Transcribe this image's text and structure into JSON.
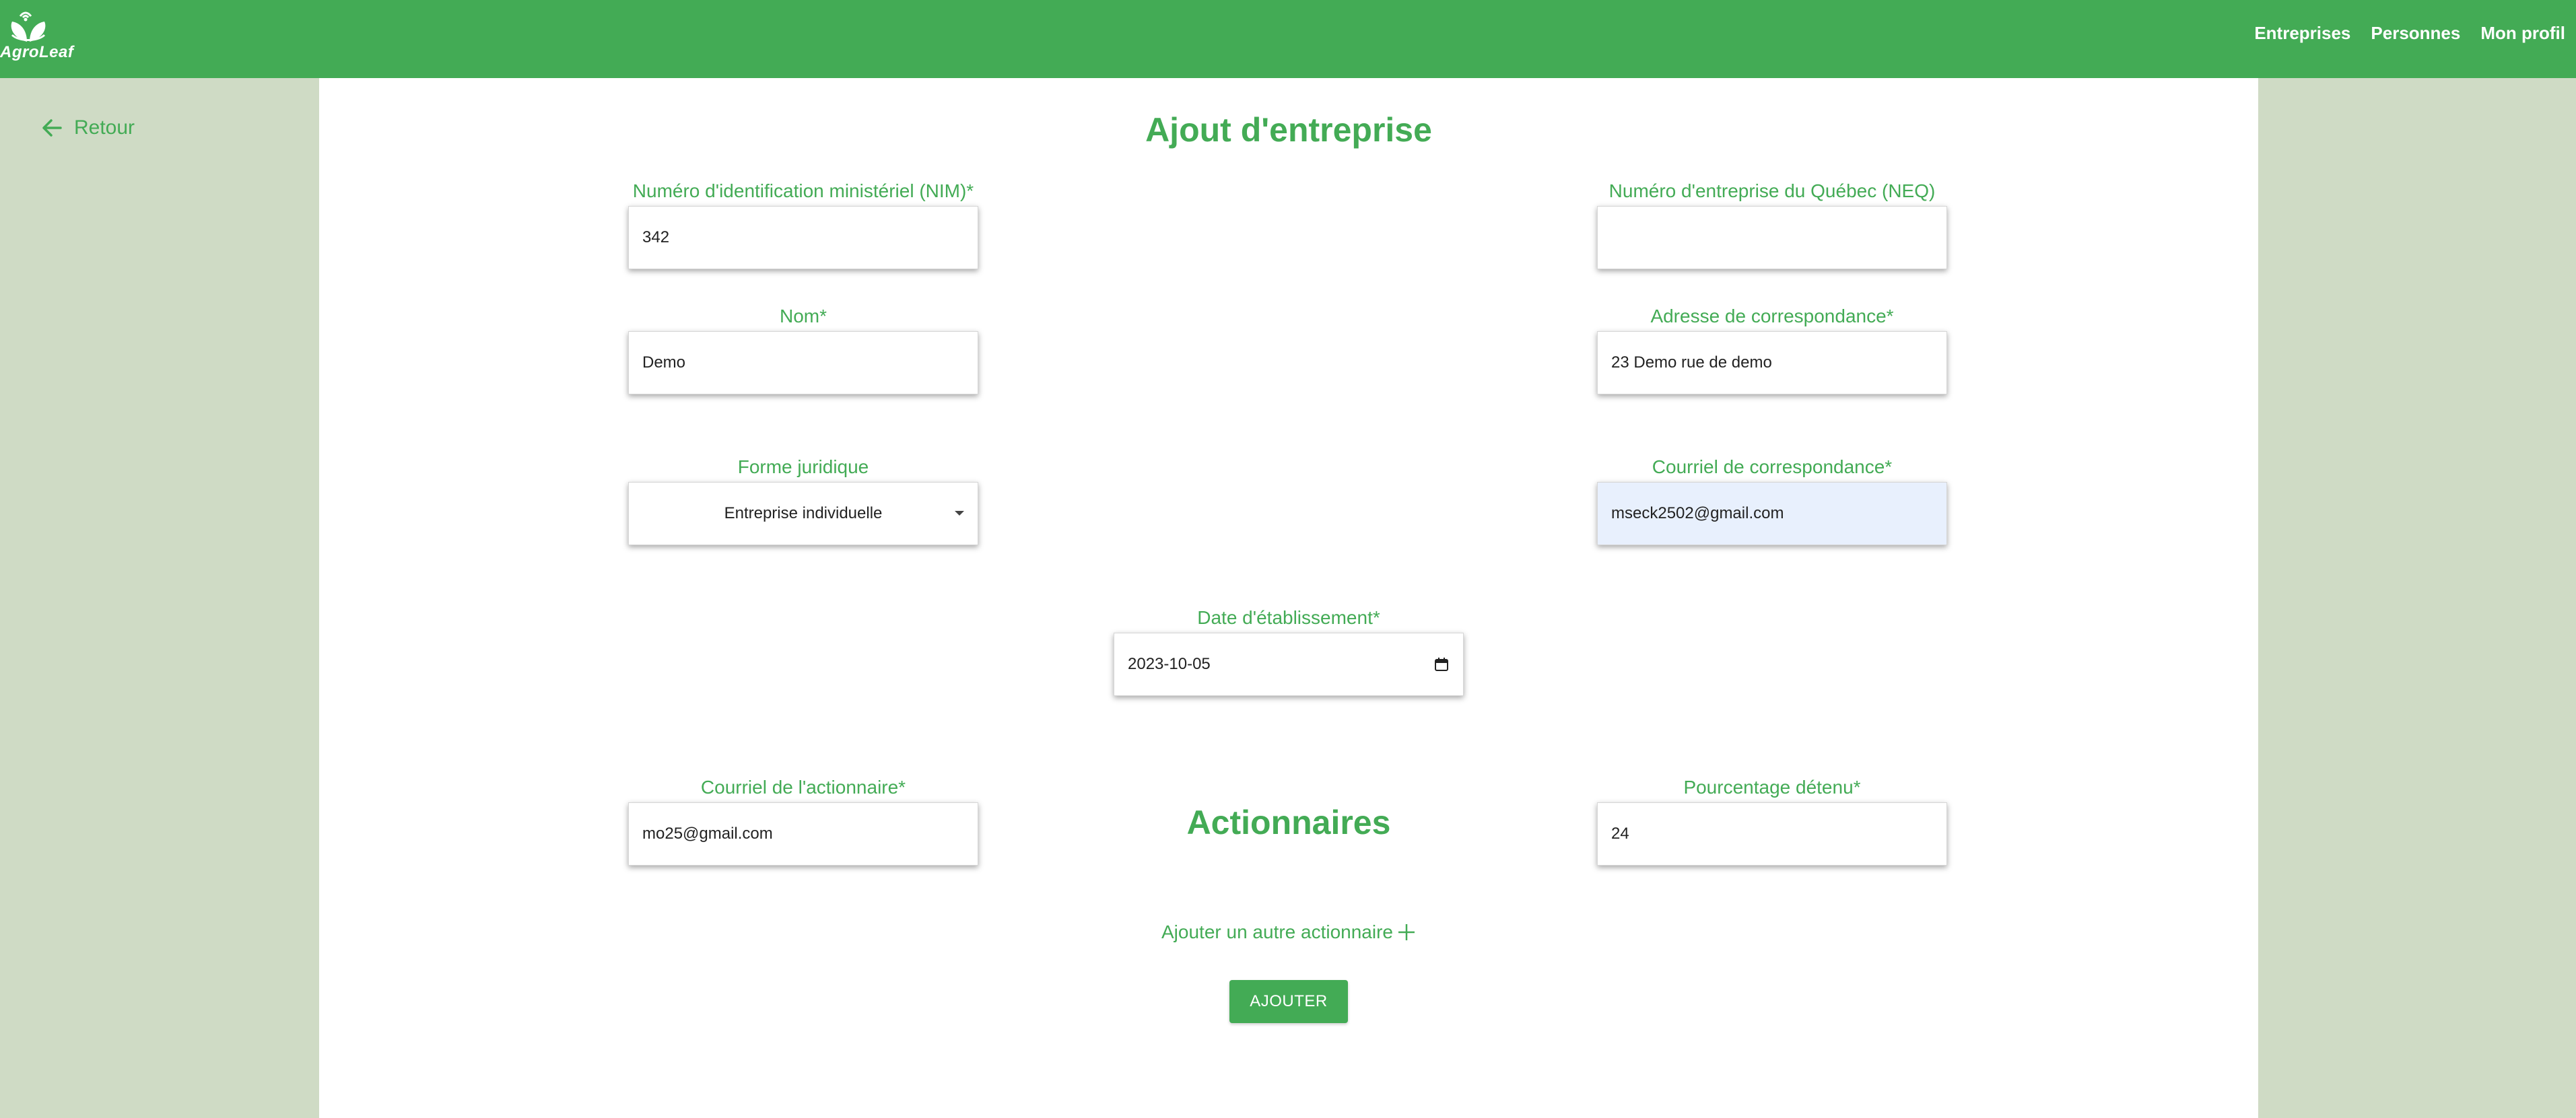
{
  "app": {
    "brand": "AgroLeaf"
  },
  "nav": {
    "links": [
      "Entreprises",
      "Personnes",
      "Mon profil"
    ]
  },
  "sidebar": {
    "back_label": "Retour"
  },
  "form": {
    "title": "Ajout d'entreprise",
    "nim": {
      "label": "Numéro d'identification ministériel (NIM)*",
      "value": "342"
    },
    "neq": {
      "label": "Numéro d'entreprise du Québec (NEQ)",
      "value": ""
    },
    "nom": {
      "label": "Nom*",
      "value": "Demo"
    },
    "adresse": {
      "label": "Adresse de correspondance*",
      "value": "23 Demo rue de demo"
    },
    "forme": {
      "label": "Forme juridique",
      "value": "Entreprise individuelle"
    },
    "courriel": {
      "label": "Courriel de correspondance*",
      "value": "mseck2502@gmail.com"
    },
    "date": {
      "label": "Date d'établissement*",
      "value": "2023-10-05"
    }
  },
  "shareholders": {
    "title": "Actionnaires",
    "email": {
      "label": "Courriel de l'actionnaire*",
      "value": "mo25@gmail.com"
    },
    "percent": {
      "label": "Pourcentage détenu*",
      "value": "24"
    },
    "add_label": "Ajouter un autre actionnaire",
    "submit_label": "AJOUTER"
  },
  "colors": {
    "brand_green": "#43ab55",
    "side_bg": "#cfdbc5",
    "autofill_bg": "#e8f0fd"
  }
}
